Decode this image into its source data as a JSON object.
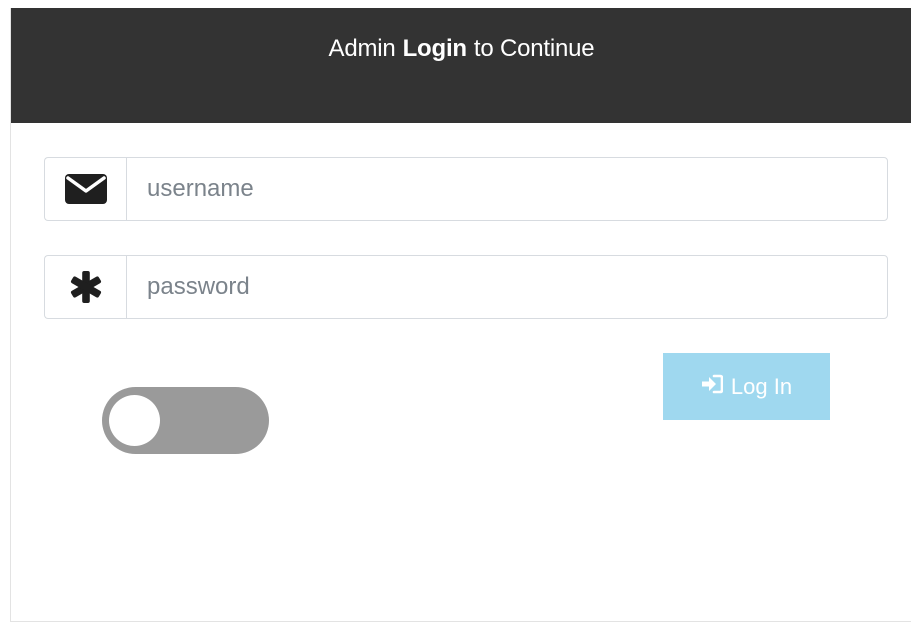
{
  "header": {
    "title_prefix": "Admin",
    "title_bold": "Login",
    "title_suffix": "to Continue"
  },
  "form": {
    "username": {
      "icon": "envelope-icon",
      "value": "",
      "placeholder": "username"
    },
    "password": {
      "icon": "asterisk-icon",
      "value": "",
      "placeholder": "password"
    },
    "login_button": {
      "icon": "sign-in-icon",
      "label": "Log In"
    },
    "toggle": {
      "state": "off"
    }
  },
  "colors": {
    "header_bg": "#333333",
    "button_bg": "#9fd8ef",
    "toggle_bg": "#9a9a9a"
  }
}
